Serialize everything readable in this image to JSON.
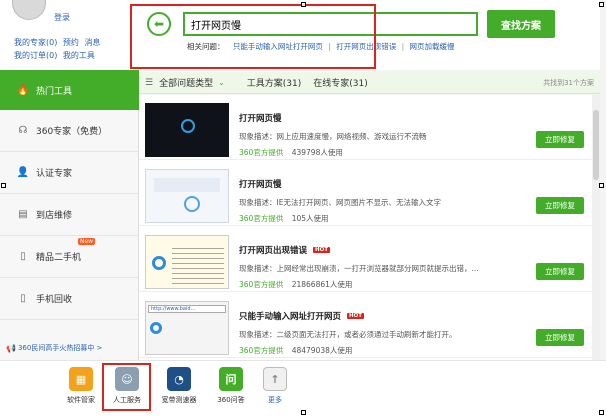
{
  "user": {
    "login_label": "登录",
    "links_row1": [
      "我的专家(0)",
      "预约",
      "消息"
    ],
    "links_row2": [
      "我的订单(0)",
      "我的工具"
    ]
  },
  "sidebar": {
    "items": [
      {
        "label": "热门工具",
        "icon": "flame-icon",
        "active": true
      },
      {
        "label": "360专家（免费）",
        "icon": "headset-icon"
      },
      {
        "label": "认证专家",
        "icon": "person-icon"
      },
      {
        "label": "到店维修",
        "icon": "store-icon"
      },
      {
        "label": "精品二手机",
        "icon": "phone-icon",
        "badge": "New"
      },
      {
        "label": "手机回收",
        "icon": "recycle-phone-icon"
      }
    ],
    "bottom_link": "360民间高手火热招募中 >"
  },
  "search": {
    "back_icon": "arrow-left-icon",
    "value": "打开网页慢",
    "button_label": "查找方案",
    "related_label": "相关问题：",
    "related_links": [
      "只能手动输入网址打开网页",
      "打开网页出现错误",
      "网页加载缓慢"
    ]
  },
  "filter": {
    "all_types": "全部问题类型",
    "tab_tools": "工具方案(31)",
    "tab_experts": "在线专家(31)",
    "count": "共找到31个方案"
  },
  "results": [
    {
      "title": "打开网页慢",
      "hot": "",
      "desc": "现象描述：网上应用速度慢，网络视频、游戏运行不流畅",
      "source": "360官方提供",
      "users": "439798人使用",
      "button": "立即修复"
    },
    {
      "title": "打开网页慢",
      "hot": "",
      "desc": "现象描述：IE无法打开网页、网页图片不显示、无法输入文字",
      "source": "360官方提供",
      "users": "105人使用",
      "button": "立即修复"
    },
    {
      "title": "打开网页出现错误",
      "hot": "HOT",
      "desc": "现象描述：上网经常出现崩溃，一打开浏览器就部分网页就提示出错，...",
      "source": "360官方提供",
      "users": "21866861人使用",
      "button": "立即修复"
    },
    {
      "title": "只能手动输入网址打开网页",
      "hot": "HOT",
      "desc": "现象描述：二级页面无法打开，或者必须通过手动刷新才能打开。",
      "source": "360官方提供",
      "users": "48479038人使用",
      "button": "立即修复"
    }
  ],
  "thumb_text": {
    "t2": "程序没有响应，要重启 Windows 并关闭该程序吗？",
    "t3": "http://www.baid..."
  },
  "apps": [
    {
      "label": "软件管家",
      "icon": "software-manager-icon",
      "color": "#f4a21b"
    },
    {
      "label": "人工服务",
      "icon": "human-service-icon",
      "color": "#8b9fb0"
    },
    {
      "label": "宽带测速器",
      "icon": "speedometer-icon",
      "color": "#1e4f86"
    },
    {
      "label": "360问答",
      "icon": "qa-icon",
      "color": "#43ac28"
    },
    {
      "label": "更多",
      "icon": "more-icon",
      "color": "#e6e6e6"
    }
  ],
  "colors": {
    "accent": "#43ac28",
    "highlight": "#d9251c",
    "link": "#2a62b3"
  }
}
